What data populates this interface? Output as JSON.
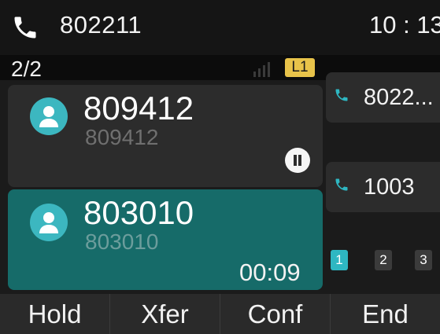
{
  "header": {
    "account": "802211",
    "time": "10 : 13",
    "icon": "phone-icon"
  },
  "status": {
    "call_count": "2/2",
    "line_label": "L1",
    "signal_icon": "signal-icon"
  },
  "calls": [
    {
      "name": "809412",
      "number": "809412",
      "state": "held",
      "icon": "contact-avatar-icon"
    },
    {
      "name": "803010",
      "number": "803010",
      "state": "active",
      "duration": "00:09",
      "icon": "contact-avatar-icon"
    }
  ],
  "side_lines": [
    {
      "label": "8022...",
      "icon": "phone-icon"
    },
    {
      "label": "1003",
      "icon": "phone-icon"
    }
  ],
  "pages": [
    "1",
    "2",
    "3"
  ],
  "active_page": "1",
  "softkeys": [
    "Hold",
    "Xfer",
    "Conf",
    "End"
  ],
  "colors": {
    "accent": "#2eb7c2",
    "active_call_bg": "#166b69",
    "line_badge": "#e8c34a",
    "background": "#1b1b1b"
  }
}
